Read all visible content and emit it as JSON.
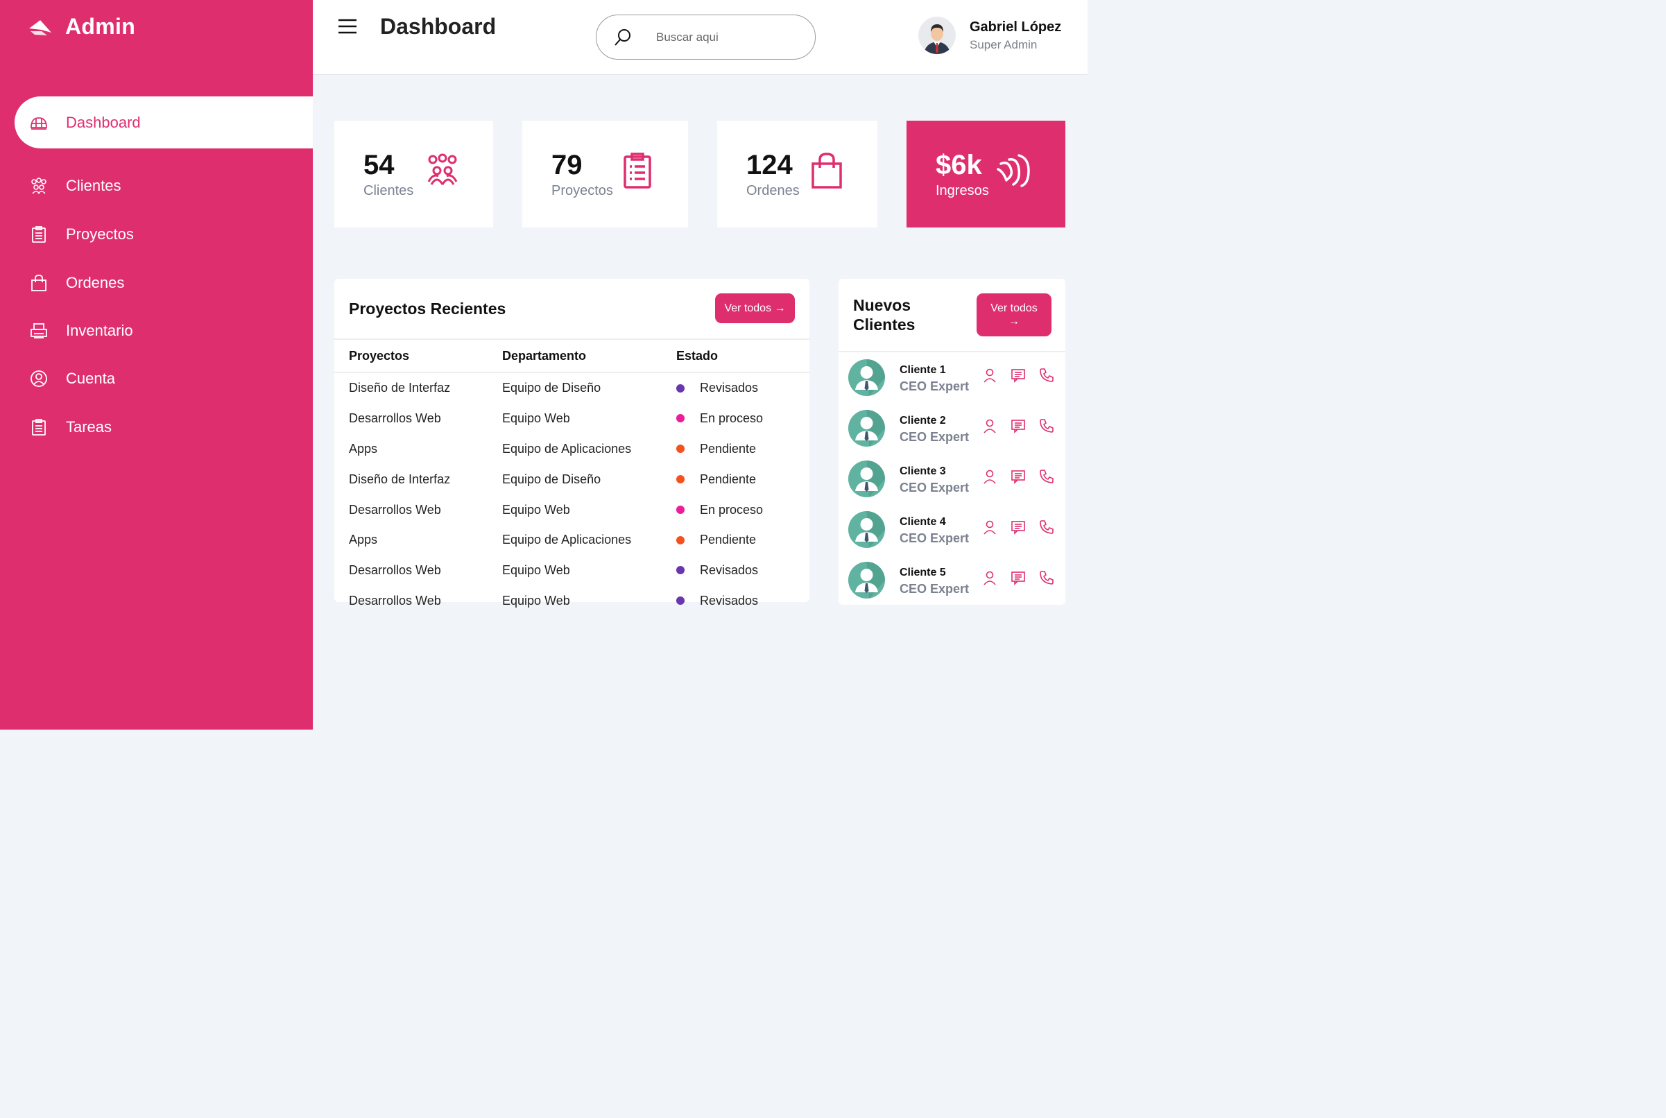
{
  "brand": {
    "name": "Admin"
  },
  "sidebar": {
    "items": [
      {
        "label": "Dashboard",
        "icon": "dashboard-icon",
        "active": true
      },
      {
        "label": "Clientes",
        "icon": "people-icon"
      },
      {
        "label": "Proyectos",
        "icon": "clipboard-icon"
      },
      {
        "label": "Ordenes",
        "icon": "shopping-bag-icon"
      },
      {
        "label": "Inventario",
        "icon": "printer-icon"
      },
      {
        "label": "Cuenta",
        "icon": "user-circle-icon"
      },
      {
        "label": "Tareas",
        "icon": "clipboard-icon"
      }
    ]
  },
  "header": {
    "title": "Dashboard",
    "search_placeholder": "Buscar aqui",
    "user_name": "Gabriel López",
    "user_role": "Super Admin"
  },
  "stats": [
    {
      "value": "54",
      "label": "Clientes",
      "icon": "people-icon"
    },
    {
      "value": "79",
      "label": "Proyectos",
      "icon": "clipboard-icon"
    },
    {
      "value": "124",
      "label": "Ordenes",
      "icon": "shopping-bag-icon"
    },
    {
      "value": "$6k",
      "label": "Ingresos",
      "icon": "cash-icon"
    }
  ],
  "recent_projects": {
    "title": "Proyectos Recientes",
    "button_label": "Ver todos →",
    "columns": [
      "Proyectos",
      "Departamento",
      "Estado"
    ],
    "rows": [
      {
        "project": "Diseño de Interfaz",
        "department": "Equipo de Diseño",
        "status": "Revisados"
      },
      {
        "project": "Desarrollos Web",
        "department": "Equipo Web",
        "status": "En proceso"
      },
      {
        "project": "Apps",
        "department": "Equipo de Aplicaciones",
        "status": "Pendiente"
      },
      {
        "project": "Diseño de Interfaz",
        "department": "Equipo de Diseño",
        "status": "Pendiente"
      },
      {
        "project": "Desarrollos Web",
        "department": "Equipo Web",
        "status": "En proceso"
      },
      {
        "project": "Apps",
        "department": "Equipo de Aplicaciones",
        "status": "Pendiente"
      },
      {
        "project": "Desarrollos Web",
        "department": "Equipo Web",
        "status": "Revisados"
      },
      {
        "project": "Desarrollos Web",
        "department": "Equipo Web",
        "status": "Revisados"
      }
    ],
    "status_colors": {
      "Revisados": "#6a35b0",
      "En proceso": "#ec1c9a",
      "Pendiente": "#f4511e"
    }
  },
  "new_clients": {
    "title": "Nuevos Clientes",
    "button_label": "Ver todos →",
    "clients": [
      {
        "name": "Cliente 1",
        "role": "CEO Expert"
      },
      {
        "name": "Cliente 2",
        "role": "CEO Expert"
      },
      {
        "name": "Cliente 3",
        "role": "CEO Expert"
      },
      {
        "name": "Cliente 4",
        "role": "CEO Expert"
      },
      {
        "name": "Cliente 5",
        "role": "CEO Expert"
      }
    ],
    "actions": [
      "user-icon",
      "message-icon",
      "phone-icon"
    ]
  },
  "colors": {
    "accent": "#df2e6e",
    "background": "#f1f4f8"
  }
}
